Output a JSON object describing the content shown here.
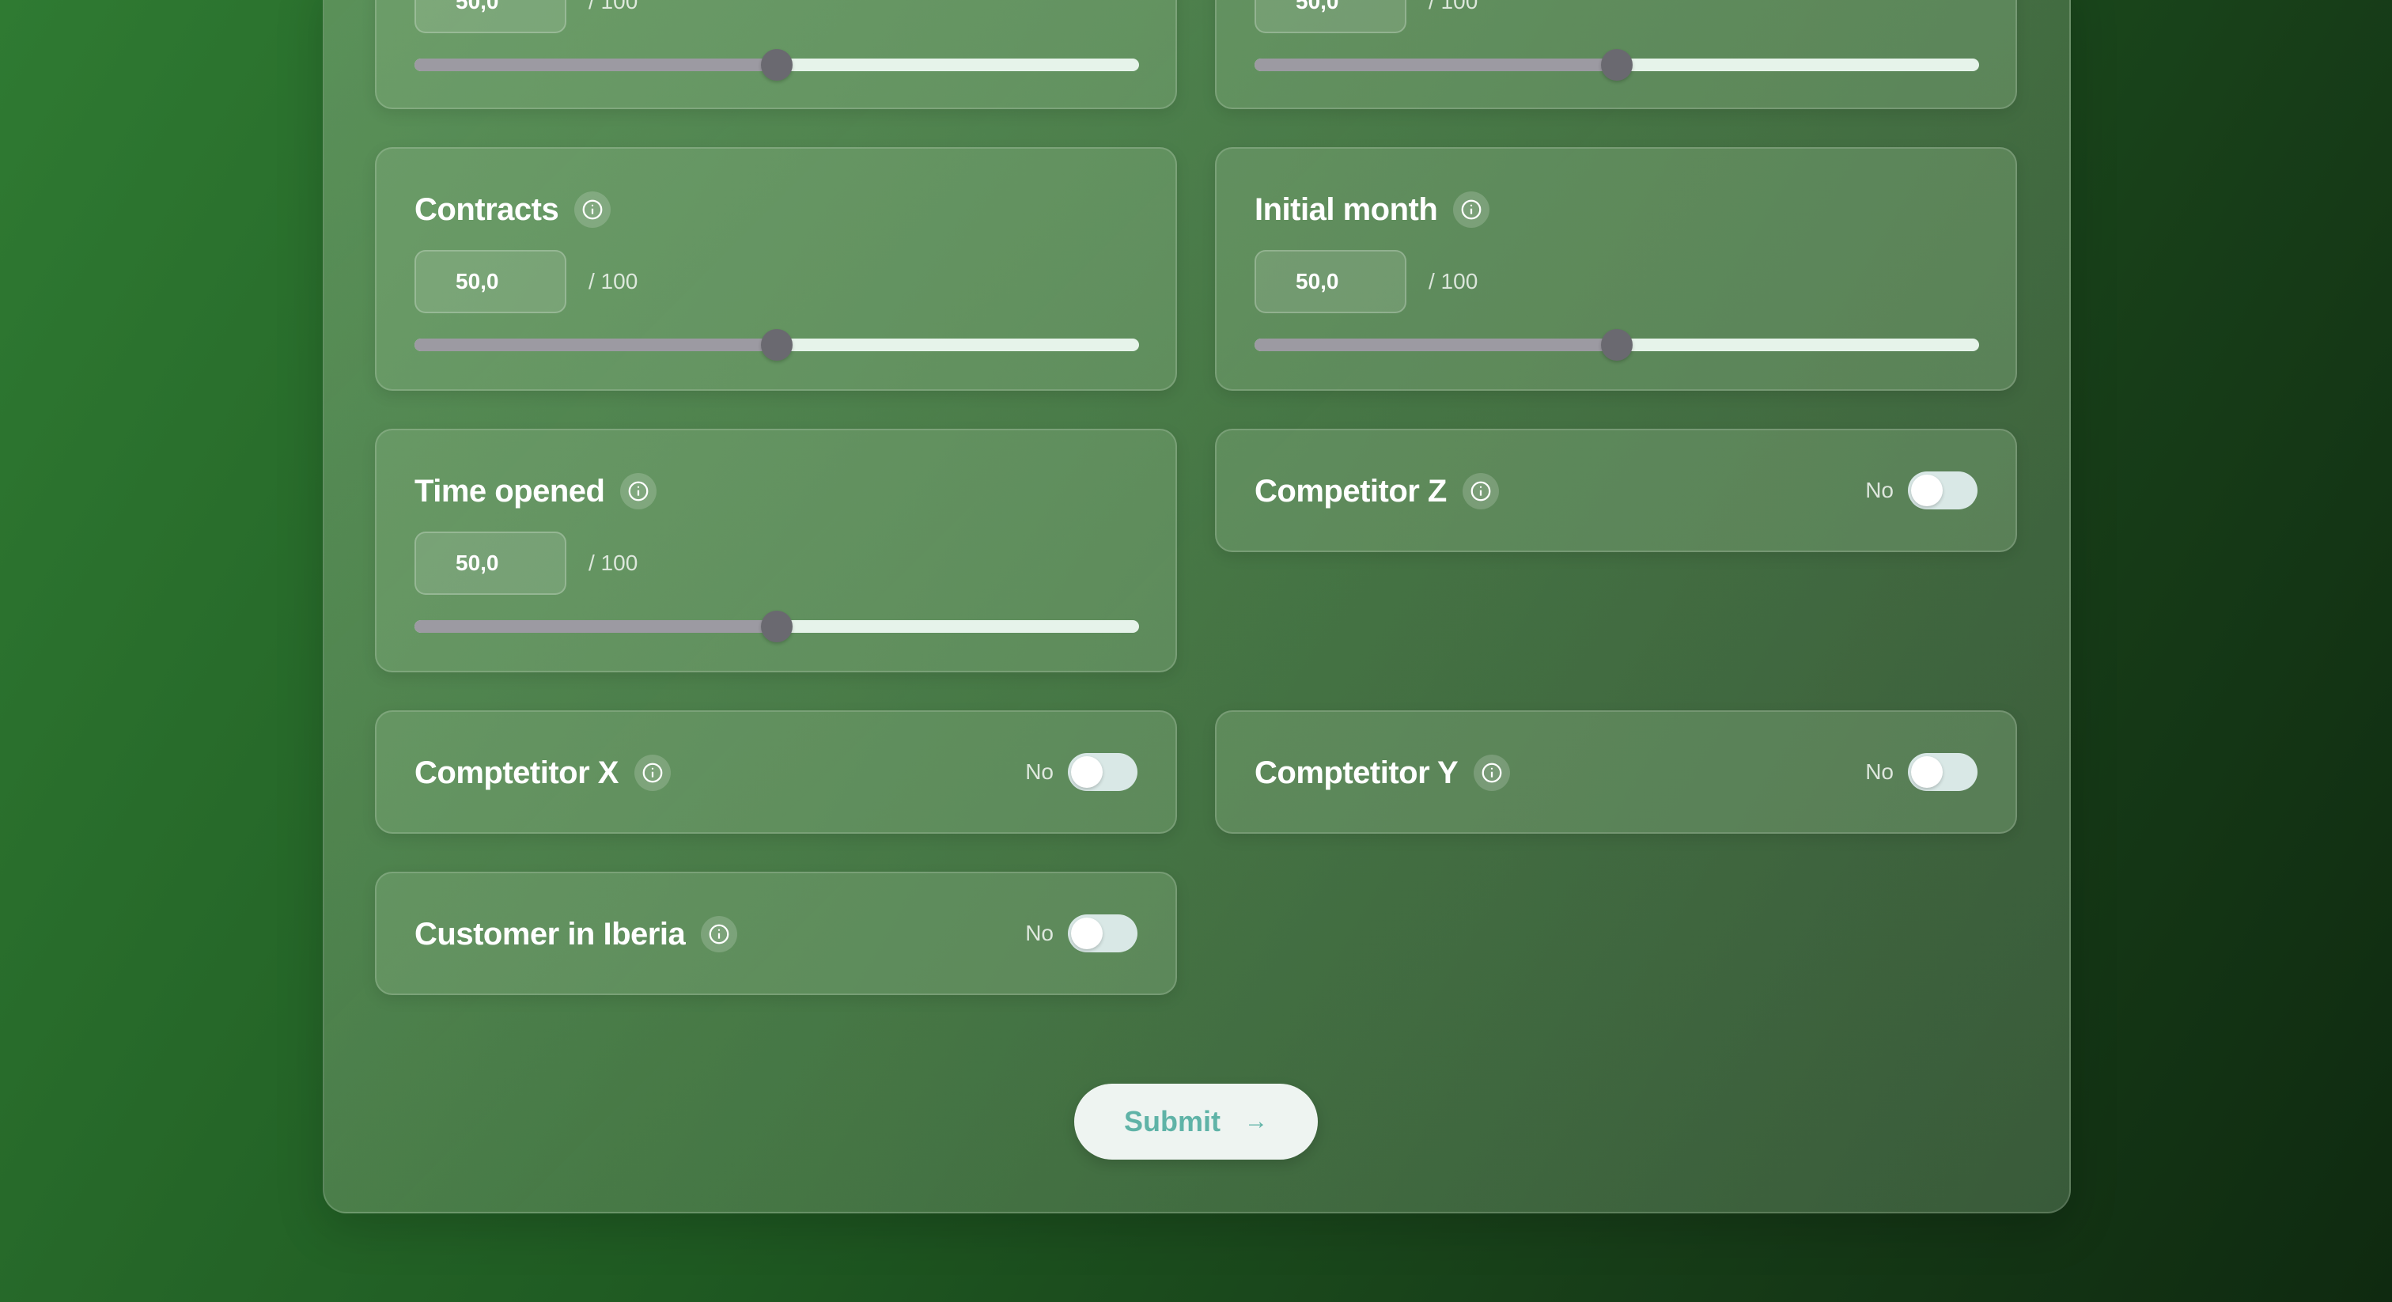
{
  "form": {
    "fields": [
      {
        "id": "top-left",
        "value": "50,0",
        "max_label": "/ 100",
        "slider_fraction": 0.5
      },
      {
        "id": "top-right",
        "value": "50,0",
        "max_label": "/ 100",
        "slider_fraction": 0.5
      },
      {
        "id": "contracts",
        "label": "Contracts",
        "value": "50,0",
        "max_label": "/ 100",
        "slider_fraction": 0.5
      },
      {
        "id": "initial-month",
        "label": "Initial month",
        "value": "50,0",
        "max_label": "/ 100",
        "slider_fraction": 0.5
      },
      {
        "id": "time-opened",
        "label": "Time opened",
        "value": "50,0",
        "max_label": "/ 100",
        "slider_fraction": 0.5
      }
    ],
    "toggles": [
      {
        "id": "competitor-z",
        "label": "Competitor Z",
        "state_text": "No",
        "on": false
      },
      {
        "id": "competitor-x",
        "label": "Comptetitor X",
        "state_text": "No",
        "on": false
      },
      {
        "id": "competitor-y",
        "label": "Comptetitor Y",
        "state_text": "No",
        "on": false
      },
      {
        "id": "customer-iberia",
        "label": "Customer in Iberia",
        "state_text": "No",
        "on": false
      }
    ],
    "submit_label": "Submit",
    "submit_icon": "arrow-right-icon"
  },
  "colors": {
    "background_start": "#2f7a32",
    "background_end": "#0f2a10",
    "slider_filled": "#9c9aa2",
    "slider_empty": "#e6f3ea",
    "slider_thumb": "#6a6970",
    "submit_text": "#5fb3a7"
  }
}
